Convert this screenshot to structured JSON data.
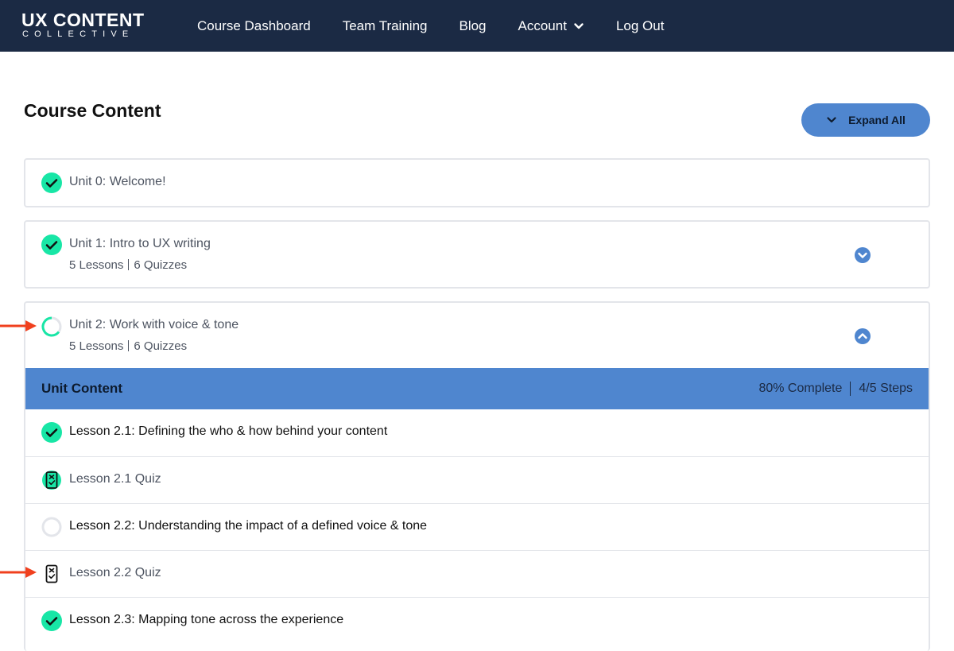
{
  "header": {
    "logo_main": "UX CONTENT",
    "logo_sub": "COLLECTIVE",
    "nav": {
      "dashboard": "Course Dashboard",
      "training": "Team Training",
      "blog": "Blog",
      "account": "Account",
      "logout": "Log Out"
    }
  },
  "page": {
    "title": "Course Content",
    "expand_label": "Expand All"
  },
  "units": {
    "u0": {
      "title": "Unit 0: Welcome!"
    },
    "u1": {
      "title": "Unit 1: Intro to UX writing",
      "lessons": "5 Lessons",
      "quizzes": "6 Quizzes"
    },
    "u2": {
      "title": "Unit 2: Work with voice & tone",
      "lessons": "5 Lessons",
      "quizzes": "6 Quizzes"
    }
  },
  "unit_content": {
    "title": "Unit Content",
    "complete": "80% Complete",
    "steps": "4/5 Steps",
    "progress_fraction": 0.8,
    "items": [
      {
        "label": "Lesson 2.1: Defining the who & how behind your content",
        "status": "complete"
      },
      {
        "label": "Lesson 2.1 Quiz",
        "status": "quiz-complete"
      },
      {
        "label": "Lesson 2.2: Understanding the impact of a defined voice & tone",
        "status": "not-started"
      },
      {
        "label": "Lesson 2.2 Quiz",
        "status": "quiz-incomplete"
      },
      {
        "label": "Lesson 2.3: Mapping tone across the experience",
        "status": "complete"
      }
    ]
  },
  "colors": {
    "header_bg": "#1b2a44",
    "accent_blue": "#4f86cf",
    "complete_green": "#18e6a6",
    "annotation_red": "#f0401e"
  },
  "icons": {
    "check": "check-circle-icon",
    "progress": "progress-ring-icon",
    "quiz": "quiz-icon",
    "empty": "empty-circle-icon",
    "chevron_down": "chevron-down-circle-icon",
    "chevron_up": "chevron-up-circle-icon",
    "arrow": "red-arrow-icon"
  }
}
